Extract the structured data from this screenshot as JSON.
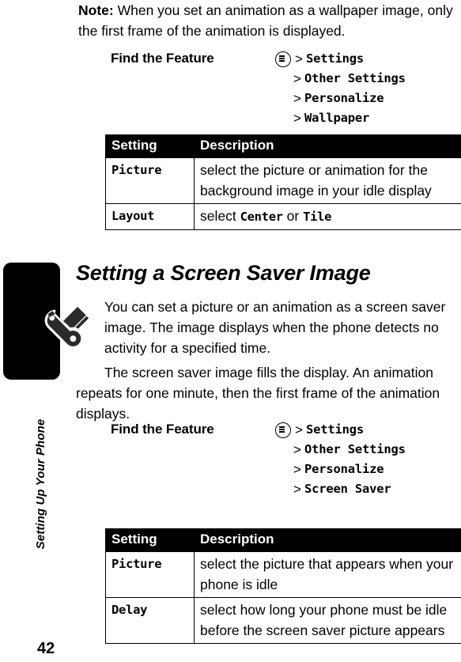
{
  "page": {
    "number": "42",
    "running_head": "Setting Up Your Phone"
  },
  "note": {
    "label": "Note:",
    "text": " When you set an animation as a wallpaper image, only the first frame of the animation is displayed."
  },
  "find_feature_wallpaper": {
    "label": "Find the Feature",
    "menu_icon": "menu-key-icon",
    "separator": ">",
    "path": [
      "Settings",
      "Other Settings",
      "Personalize",
      "Wallpaper"
    ]
  },
  "wallpaper_table": {
    "headers": [
      "Setting",
      "Description"
    ],
    "rows": [
      {
        "setting": "Picture",
        "description": "select the picture or animation for the background image in your idle display"
      },
      {
        "setting": "Layout",
        "desc_prefix": "select ",
        "desc_option_1": "Center",
        "desc_middle": " or ",
        "desc_option_2": "Tile"
      }
    ]
  },
  "section": {
    "heading": "Setting a Screen Saver Image",
    "icon": "wrench-screwdriver-icon",
    "paragraph_1": "You can set a picture or an animation as a screen saver image. The image displays when the phone detects no activity for a specified time.",
    "paragraph_2": "The screen saver image fills the display. An animation repeats for one minute, then the first frame of the animation displays."
  },
  "find_feature_screensaver": {
    "label": "Find the Feature",
    "menu_icon": "menu-key-icon",
    "separator": ">",
    "path": [
      "Settings",
      "Other Settings",
      "Personalize",
      "Screen Saver"
    ]
  },
  "screensaver_table": {
    "headers": [
      "Setting",
      "Description"
    ],
    "rows": [
      {
        "setting": "Picture",
        "description": "select the picture that appears when your phone is idle"
      },
      {
        "setting": "Delay",
        "description": "select how long your phone must be idle before the screen saver picture appears"
      }
    ]
  }
}
